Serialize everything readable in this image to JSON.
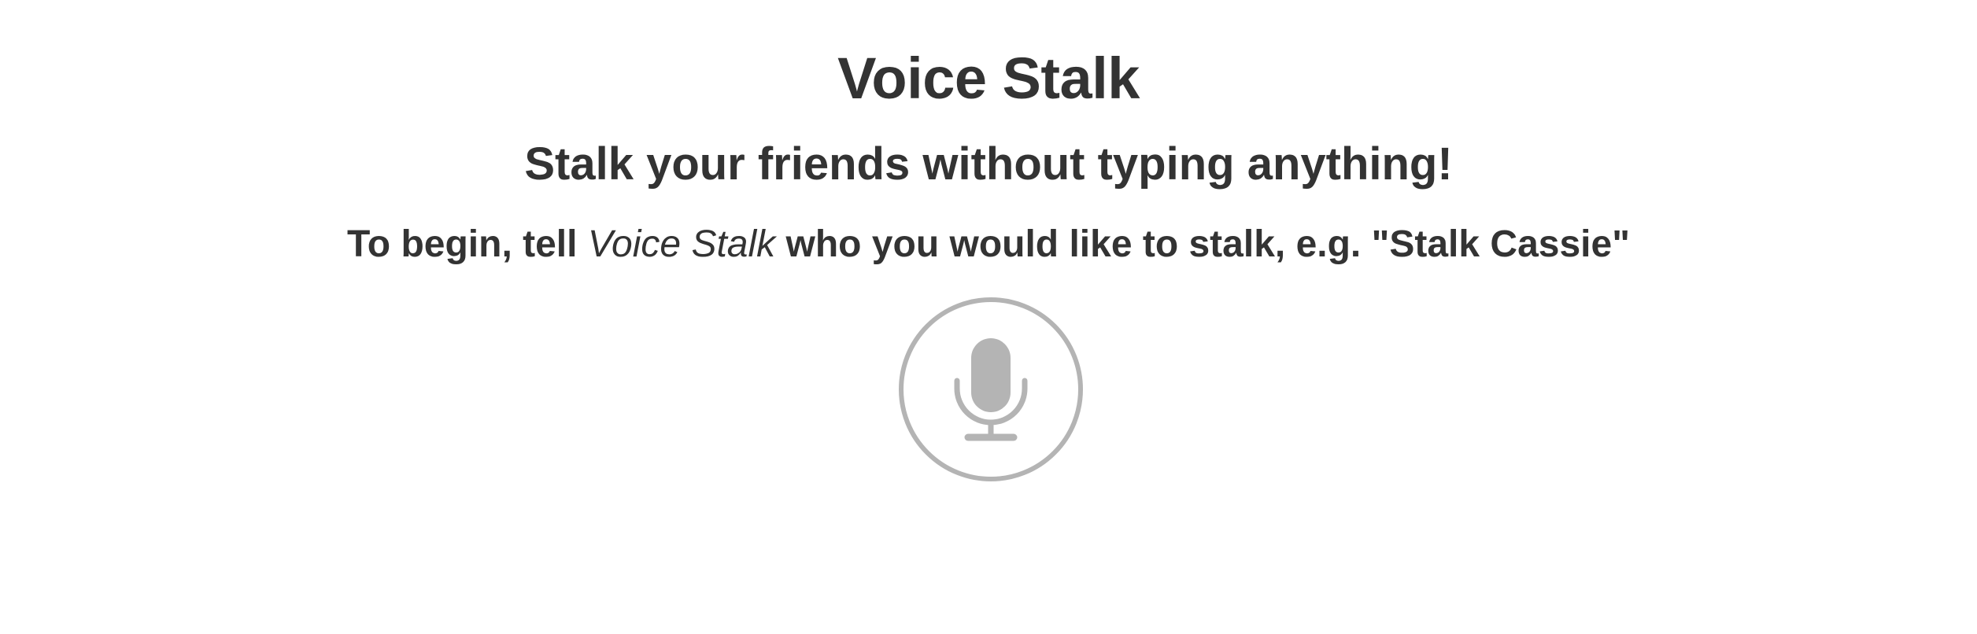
{
  "header": {
    "title": "Voice Stalk",
    "subtitle": "Stalk your friends without typing anything!"
  },
  "instructions": {
    "prefix": "To begin, tell ",
    "app_name": "Voice Stalk",
    "suffix": " who you would like to stalk, e.g. \"Stalk Cassie\""
  },
  "mic": {
    "icon": "microphone-icon",
    "color": "#b4b4b4"
  },
  "colors": {
    "text": "#333333",
    "background": "#ffffff"
  }
}
